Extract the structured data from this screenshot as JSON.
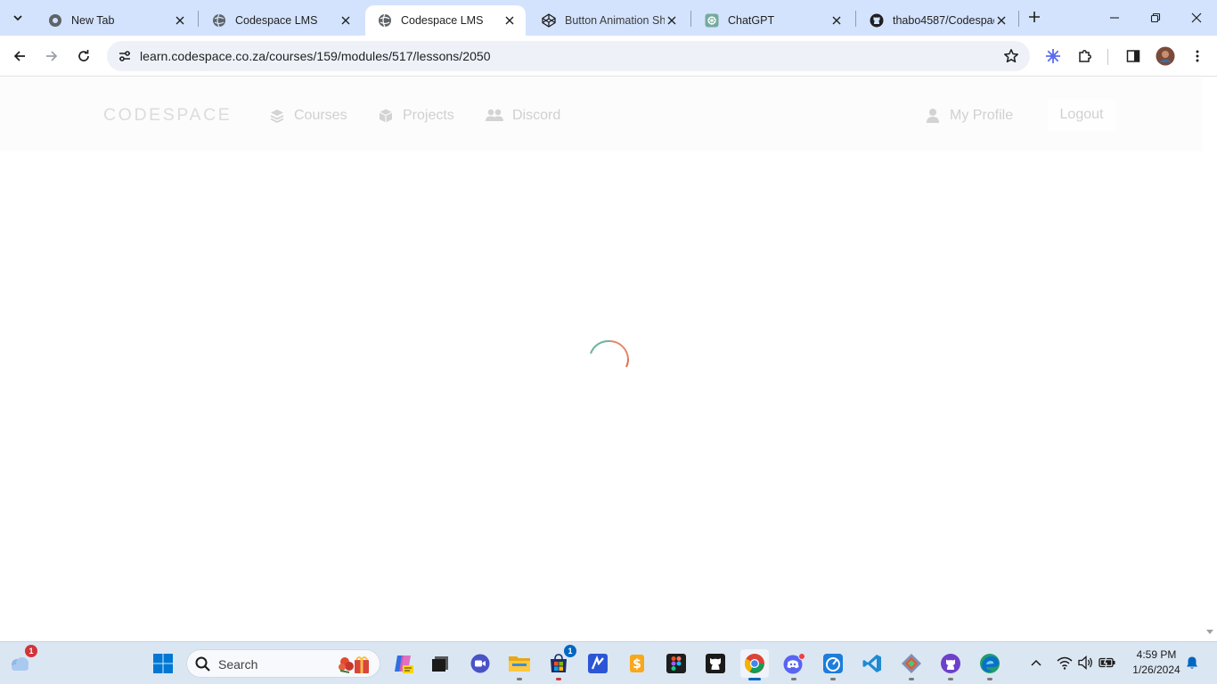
{
  "browser": {
    "tabs": [
      {
        "title": "New Tab",
        "favicon": "chrome-icon",
        "active": false
      },
      {
        "title": "Codespace LMS",
        "favicon": "globe-icon",
        "active": false
      },
      {
        "title": "Codespace LMS",
        "favicon": "globe-icon",
        "active": true
      },
      {
        "title": "Button Animation Sh",
        "favicon": "codepen-icon",
        "active": false
      },
      {
        "title": "ChatGPT",
        "favicon": "chatgpt-icon",
        "active": false
      },
      {
        "title": "thabo4587/Codespac",
        "favicon": "github-icon",
        "active": false
      }
    ],
    "url": "learn.codespace.co.za/courses/159/modules/517/lessons/2050"
  },
  "site": {
    "logo": "CODESPACE",
    "nav": {
      "courses": "Courses",
      "projects": "Projects",
      "discord": "Discord",
      "profile": "My Profile",
      "logout": "Logout"
    },
    "status": "loading-spinner"
  },
  "taskbar": {
    "weather_badge": "1",
    "search_label": "Search",
    "store_badge": "1",
    "time": "4:59 PM",
    "date": "1/26/2024"
  },
  "colors": {
    "tabstrip": "#d3e3fd",
    "taskbar": "#dbe6f3",
    "spinner_green": "#6bb59c",
    "spinner_orange": "#e2704a",
    "nav_text": "#d0d0d0"
  }
}
